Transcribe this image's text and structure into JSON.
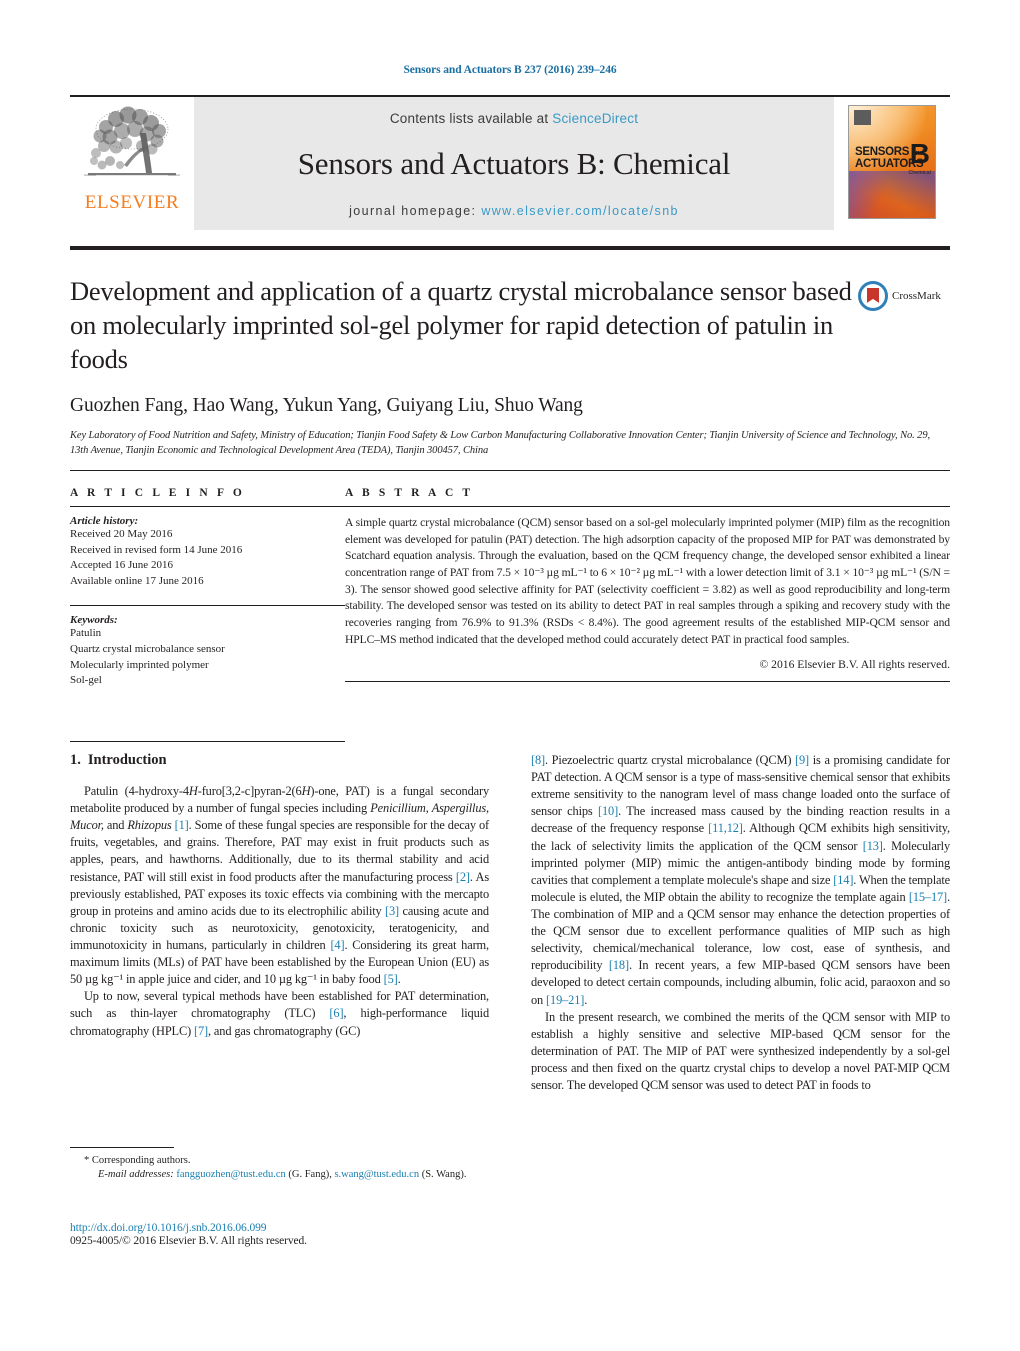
{
  "running_head": "Sensors and Actuators B 237 (2016) 239–246",
  "masthead": {
    "publisher_name": "ELSEVIER",
    "contents_prefix": "Contents lists available at ",
    "contents_link": "ScienceDirect",
    "journal_title": "Sensors and Actuators B: Chemical",
    "homepage_prefix": "journal homepage: ",
    "homepage_url": "www.elsevier.com/locate/snb",
    "cover": {
      "line1": "SENSORS",
      "line1_small": "and",
      "line2": "ACTUATORS",
      "letter": "B",
      "sub": "Chemical"
    }
  },
  "article": {
    "title": "Development and application of a quartz crystal microbalance sensor based on molecularly imprinted sol-gel polymer for rapid detection of patulin in foods",
    "crossmark_label": "CrossMark",
    "authors": "Guozhen Fang, Hao Wang, Yukun Yang, Guiyang Liu, Shuo Wang",
    "affiliation": "Key Laboratory of Food Nutrition and Safety, Ministry of Education; Tianjin Food Safety & Low Carbon Manufacturing Collaborative Innovation Center; Tianjin University of Science and Technology, No. 29, 13th Avenue, Tianjin Economic and Technological Development Area (TEDA), Tianjin 300457, China"
  },
  "article_info": {
    "heading": "A R T I C L E   I N F O",
    "history_label": "Article history:",
    "history": [
      "Received 20 May 2016",
      "Received in revised form 14 June 2016",
      "Accepted 16 June 2016",
      "Available online 17 June 2016"
    ],
    "keywords_label": "Keywords:",
    "keywords": [
      "Patulin",
      "Quartz crystal microbalance sensor",
      "Molecularly imprinted polymer",
      "Sol-gel"
    ]
  },
  "abstract": {
    "heading": "A B S T R A C T",
    "text": "A simple quartz crystal microbalance (QCM) sensor based on a sol-gel molecularly imprinted polymer (MIP) film as the recognition element was developed for patulin (PAT) detection. The high adsorption capacity of the proposed MIP for PAT was demonstrated by Scatchard equation analysis. Through the evaluation, based on the QCM frequency change, the developed sensor exhibited a linear concentration range of PAT from 7.5 × 10⁻³ µg mL⁻¹ to 6 × 10⁻² µg mL⁻¹ with a lower detection limit of 3.1 × 10⁻³ µg mL⁻¹ (S/N = 3). The sensor showed good selective affinity for PAT (selectivity coefficient = 3.82) as well as good reproducibility and long-term stability. The developed sensor was tested on its ability to detect PAT in real samples through a spiking and recovery study with the recoveries ranging from 76.9% to 91.3% (RSDs < 8.4%). The good agreement results of the established MIP-QCM sensor and HPLC–MS method indicated that the developed method could accurately detect PAT in practical food samples.",
    "copyright": "© 2016 Elsevier B.V. All rights reserved."
  },
  "body": {
    "section_number": "1.",
    "section_title": "Introduction",
    "paragraph_1_a": "Patulin (4-hydroxy-4",
    "paragraph_1_b": "-furo[3,2-c]pyran-2(6",
    "paragraph_1_c": ")-one, PAT) is a fungal secondary metabolite produced by a number of fungal species including ",
    "species_1": "Penicillium, Aspergillus, Mucor,",
    "paragraph_1_d": " and ",
    "species_2": "Rhizopus",
    "paragraph_1_e": ". Some of these fungal species are responsible for the decay of fruits, vegetables, and grains. Therefore, PAT may exist in fruit products such as apples, pears, and hawthorns. Additionally, due to its thermal stability and acid resistance, PAT will still exist in food products after the manufacturing process ",
    "paragraph_1_f": ". As previously established, PAT exposes its toxic effects via combining with the mercapto group in proteins and amino acids due to its electrophilic ability ",
    "paragraph_1_g": " causing acute and chronic toxicity such as neurotoxicity, genotoxicity, teratogenicity, and immunotoxicity in humans, particularly in children ",
    "paragraph_1_h": ". Considering its great harm, maximum limits (MLs) of PAT have been established by the European Union (EU) as 50 µg kg⁻¹ in apple juice and cider, and 10 µg kg⁻¹ in baby food ",
    "paragraph_1_i": ".",
    "paragraph_2_a": "Up to now, several typical methods have been established for PAT determination, such as thin-layer chromatography (TLC) ",
    "paragraph_2_b": ", high-performance liquid chromatography (HPLC) ",
    "paragraph_2_c": ", and gas chromatography (GC) ",
    "paragraph_2_d": ". Piezoelectric quartz crystal microbalance (QCM) ",
    "paragraph_2_e": " is a promising candidate for PAT detection. A QCM sensor is a type of mass-sensitive chemical sensor that exhibits extreme sensitivity to the nanogram level of mass change loaded onto the surface of sensor chips ",
    "paragraph_2_f": ". The increased mass caused by the binding reaction results in a decrease of the frequency response ",
    "paragraph_2_g": ". Although QCM exhibits high sensitivity, the lack of selectivity limits the application of the QCM sensor ",
    "paragraph_2_h": ". Molecularly imprinted polymer (MIP) mimic the antigen-antibody binding mode by forming cavities that complement a template molecule's shape and size ",
    "paragraph_2_i": ". When the template molecule is eluted, the MIP obtain the ability to recognize the template again ",
    "paragraph_2_j": ". The combination of MIP and a QCM sensor may enhance the detection properties of the QCM sensor due to excellent performance qualities of MIP such as high selectivity, chemical/mechanical tolerance, low cost, ease of synthesis, and reproducibility ",
    "paragraph_2_k": ". In recent years, a few MIP-based QCM sensors have been developed to detect certain compounds, including albumin, folic acid, paraoxon and so on ",
    "paragraph_2_l": ".",
    "paragraph_3": "In the present research, we combined the merits of the QCM sensor with MIP to establish a highly sensitive and selective MIP-based QCM sensor for the determination of PAT. The MIP of PAT were synthesized independently by a sol-gel process and then fixed on the quartz crystal chips to develop a novel PAT-MIP QCM sensor. The developed QCM sensor was used to detect PAT in foods to",
    "refs": {
      "r1": "[1]",
      "r2": "[2]",
      "r3": "[3]",
      "r4": "[4]",
      "r5": "[5]",
      "r6": "[6]",
      "r7": "[7]",
      "r8": "[8]",
      "r9": "[9]",
      "r10": "[10]",
      "r11_12": "[11,12]",
      "r13": "[13]",
      "r14": "[14]",
      "r15_17": "[15–17]",
      "r18": "[18]",
      "r19_21": "[19–21]"
    }
  },
  "footnote": {
    "corresponding": "* Corresponding authors.",
    "email_label": "E-mail addresses:",
    "email_1": "fangguozhen@tust.edu.cn",
    "email_1_who": " (G. Fang),",
    "email_2": "s.wang@tust.edu.cn",
    "email_2_who": "(S. Wang)."
  },
  "doi": {
    "link": "http://dx.doi.org/10.1016/j.snb.2016.06.099",
    "rights": "0925-4005/© 2016 Elsevier B.V. All rights reserved."
  },
  "colors": {
    "link_blue": "#1a7fb0",
    "sciencedirect_blue": "#3a9ac4",
    "elsevier_orange": "#f57d20",
    "masthead_gray": "#e8e8e9"
  }
}
